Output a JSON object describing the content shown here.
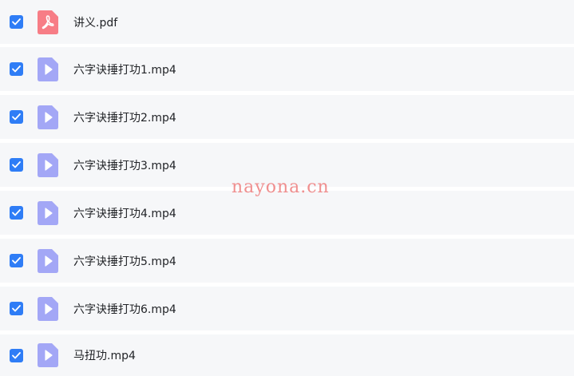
{
  "files": [
    {
      "name": "讲义.pdf",
      "type": "pdf",
      "icon": "pdf-icon",
      "checked": true
    },
    {
      "name": "六字诀捶打功1.mp4",
      "type": "video",
      "icon": "video-file-icon",
      "checked": true
    },
    {
      "name": "六字诀捶打功2.mp4",
      "type": "video",
      "icon": "video-file-icon",
      "checked": true
    },
    {
      "name": "六字诀捶打功3.mp4",
      "type": "video",
      "icon": "video-file-icon",
      "checked": true
    },
    {
      "name": "六字诀捶打功4.mp4",
      "type": "video",
      "icon": "video-file-icon",
      "checked": true
    },
    {
      "name": "六字诀捶打功5.mp4",
      "type": "video",
      "icon": "video-file-icon",
      "checked": true
    },
    {
      "name": "六字诀捶打功6.mp4",
      "type": "video",
      "icon": "video-file-icon",
      "checked": true
    },
    {
      "name": "马扭功.mp4",
      "type": "video",
      "icon": "video-file-icon",
      "checked": true
    }
  ],
  "watermark": "nayona.cn",
  "colors": {
    "checkbox": "#2f7df6",
    "pdf_icon": "#f77d86",
    "video_icon": "#a3a7f6",
    "row_background": "#f6f7f9",
    "watermark": "#f08f8f"
  }
}
